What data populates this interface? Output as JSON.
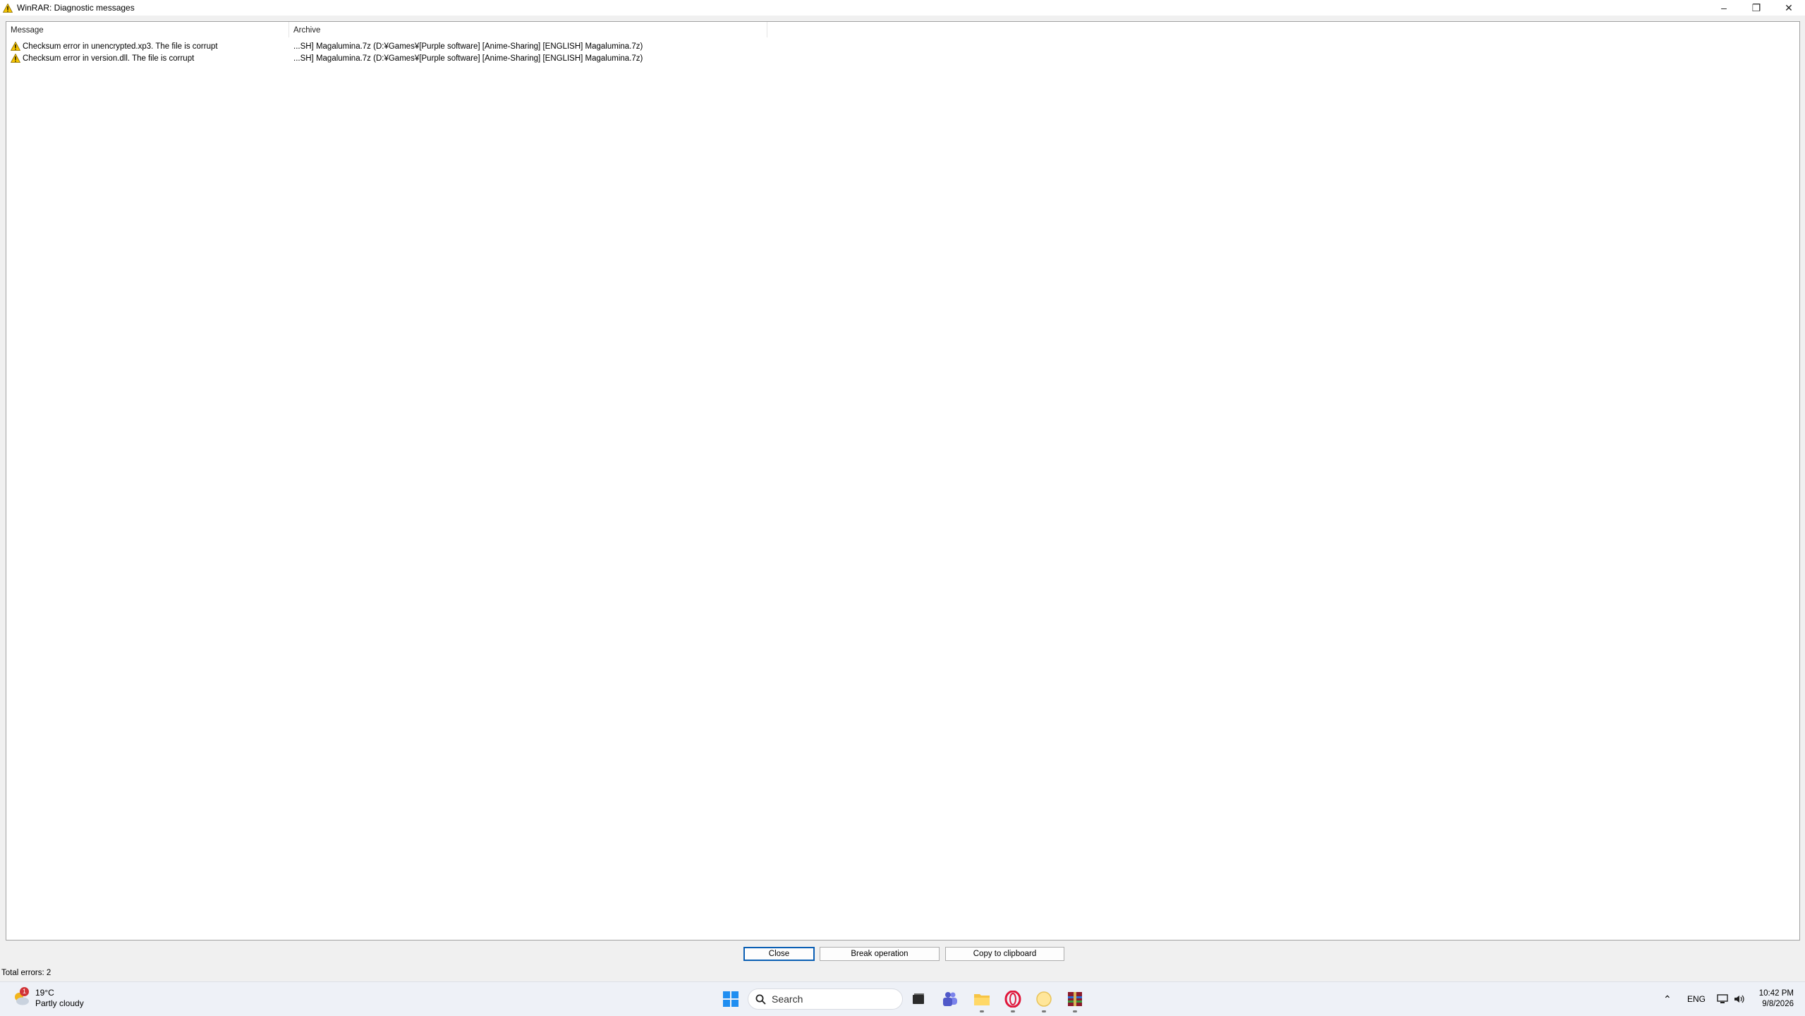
{
  "window": {
    "title": "WinRAR: Diagnostic messages"
  },
  "listview": {
    "columns": [
      "Message",
      "Archive"
    ],
    "rows": [
      {
        "message": "Checksum error in unencrypted.xp3. The file is corrupt",
        "archive": "...SH] Magalumina.7z (D:¥Games¥[Purple software] [Anime-Sharing] [ENGLISH] Magalumina.7z)"
      },
      {
        "message": "Checksum error in version.dll. The file is corrupt",
        "archive": "...SH] Magalumina.7z (D:¥Games¥[Purple software] [Anime-Sharing] [ENGLISH] Magalumina.7z)"
      }
    ]
  },
  "buttons": {
    "close": "Close",
    "break": "Break operation",
    "copy": "Copy to clipboard"
  },
  "status": "Total errors: 2",
  "taskbar": {
    "weather_temp": "19°C",
    "weather_desc": "Partly cloudy",
    "weather_badge": "1",
    "search_placeholder": "Search",
    "language": "ENG",
    "time": "10:42 PM",
    "date": "9/8/2026"
  },
  "colors": {
    "accent": "#0a5fb4",
    "warning": "#f5c400"
  }
}
